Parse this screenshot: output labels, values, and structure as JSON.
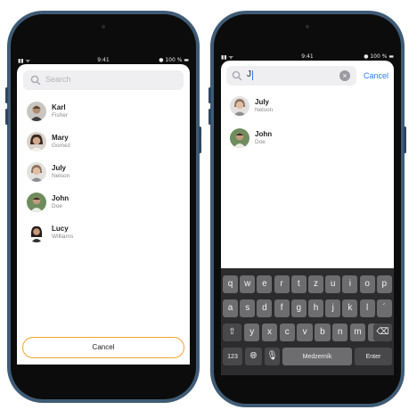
{
  "colors": {
    "accent": "#f2a530",
    "link": "#2a7df0",
    "frame": "#3f5b75"
  },
  "status_bar": {
    "time": "9:41",
    "battery": "100 %"
  },
  "left_screen": {
    "search": {
      "placeholder": "Search"
    },
    "contacts": [
      {
        "first": "Karl",
        "last": "Fisher"
      },
      {
        "first": "Mary",
        "last": "Gomez"
      },
      {
        "first": "July",
        "last": "Nelson"
      },
      {
        "first": "John",
        "last": "Doe"
      },
      {
        "first": "Lucy",
        "last": "Williams"
      }
    ],
    "cancel_label": "Cancel"
  },
  "right_screen": {
    "search": {
      "value": "J",
      "cancel_label": "Cancel"
    },
    "results": [
      {
        "first": "July",
        "last": "Nelson"
      },
      {
        "first": "John",
        "last": "Doe"
      }
    ],
    "keyboard": {
      "row1": [
        "q",
        "w",
        "e",
        "r",
        "t",
        "z",
        "u",
        "i",
        "o",
        "p"
      ],
      "row2": [
        "a",
        "s",
        "d",
        "f",
        "g",
        "h",
        "j",
        "k",
        "l",
        "´"
      ],
      "row3": [
        "y",
        "x",
        "c",
        "v",
        "b",
        "n",
        "m",
        "ˇ"
      ],
      "shift_icon": "shift-icon",
      "backspace_icon": "backspace-icon",
      "numbers_label": "123",
      "globe_icon": "globe-icon",
      "mic_icon": "microphone-icon",
      "space_label": "Medzerník",
      "enter_label": "Enter"
    }
  }
}
